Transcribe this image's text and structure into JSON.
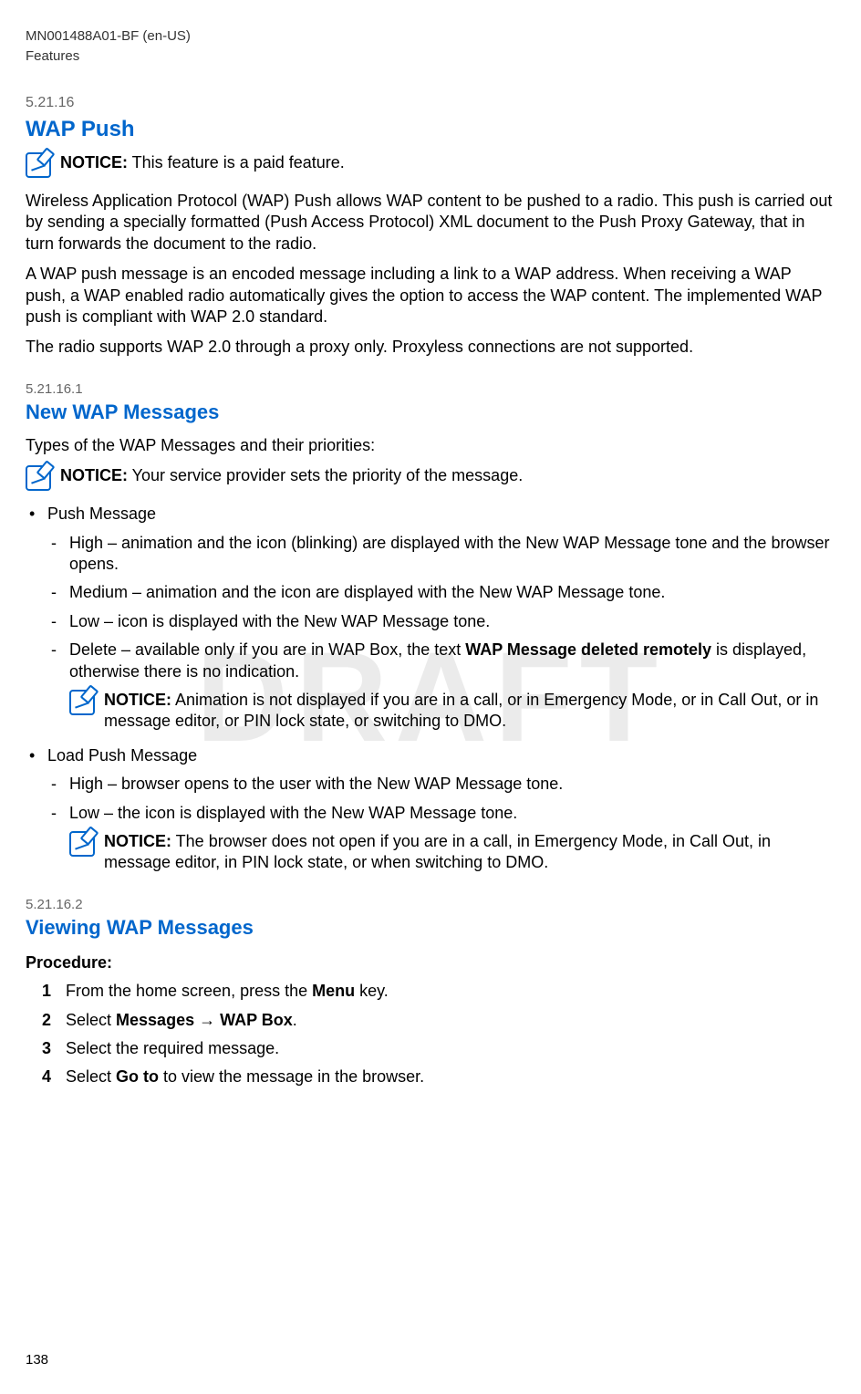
{
  "header": {
    "doc_id": "MN001488A01-BF (en-US)",
    "section_label": "Features"
  },
  "watermark": "DRAFT",
  "s1": {
    "num": "5.21.16",
    "title": "WAP Push",
    "notice_label": "NOTICE:",
    "notice_text": " This feature is a paid feature.",
    "p1": "Wireless Application Protocol (WAP) Push allows WAP content to be pushed to a radio. This push is carried out by sending a specially formatted (Push Access Protocol) XML document to the Push Proxy Gateway, that in turn forwards the document to the radio.",
    "p2": "A WAP push message is an encoded message including a link to a WAP address. When receiving a WAP push, a WAP enabled radio automatically gives the option to access the WAP content. The implemented WAP push is compliant with WAP 2.0 standard.",
    "p3": "The radio supports WAP 2.0 through a proxy only. Proxyless connections are not supported."
  },
  "s2": {
    "num": "5.21.16.1",
    "title": "New WAP Messages",
    "intro": "Types of the WAP Messages and their priorities:",
    "notice_label": "NOTICE:",
    "notice_text": " Your service provider sets the priority of the message.",
    "b1": {
      "title": "Push Message",
      "i1": "High – animation and the icon (blinking) are displayed with the New WAP Message tone and the browser opens.",
      "i2": "Medium – animation and the icon are displayed with the New WAP Message tone.",
      "i3": "Low – icon is displayed with the New WAP Message tone.",
      "i4a": "Delete – available only if you are in WAP Box, the text ",
      "i4b": "WAP Message deleted remotely",
      "i4c": " is displayed, otherwise there is no indication.",
      "notice_label": "NOTICE:",
      "notice_text": " Animation is not displayed if you are in a call, or in Emergency Mode, or in Call Out, or in message editor, or PIN lock state, or switching to DMO."
    },
    "b2": {
      "title": "Load Push Message",
      "i1": "High – browser opens to the user with the New WAP Message tone.",
      "i2": "Low – the icon is displayed with the New WAP Message tone.",
      "notice_label": "NOTICE:",
      "notice_text": " The browser does not open if you are in a call, in Emergency Mode, in Call Out, in message editor, in PIN lock state, or when switching to DMO."
    }
  },
  "s3": {
    "num": "5.21.16.2",
    "title": "Viewing WAP Messages",
    "proc_label": "Procedure:",
    "steps": {
      "n1": "1",
      "t1a": "From the home screen, press the ",
      "t1b": "Menu",
      "t1c": " key.",
      "n2": "2",
      "t2a": "Select ",
      "t2b": "Messages",
      "t2c": " → ",
      "t2d": "WAP Box",
      "t2e": ".",
      "n3": "3",
      "t3": "Select the required message.",
      "n4": "4",
      "t4a": "Select ",
      "t4b": "Go to",
      "t4c": " to view the message in the browser."
    }
  },
  "page_number": "138"
}
